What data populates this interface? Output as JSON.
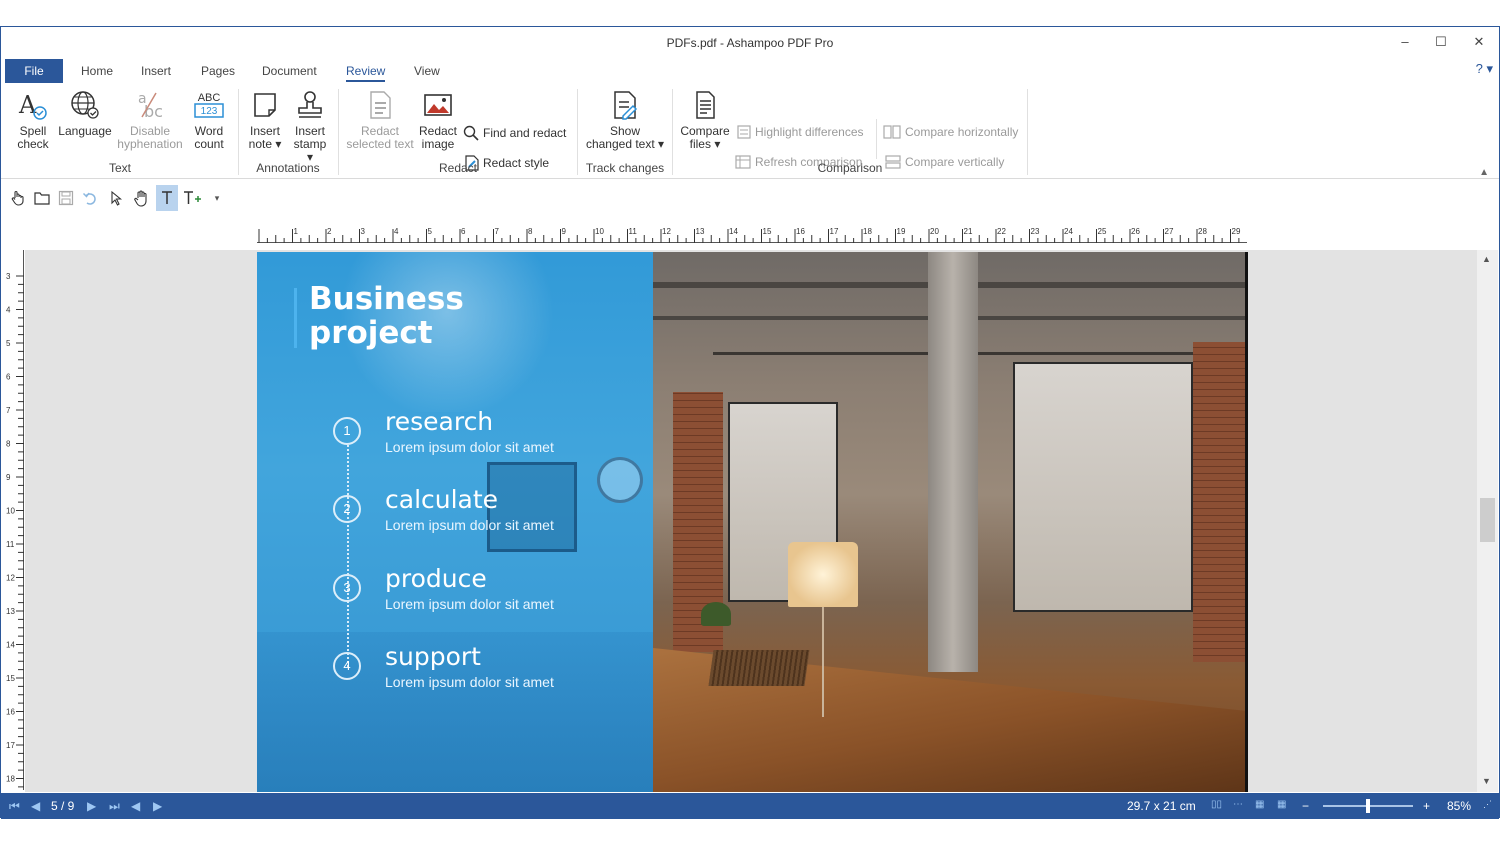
{
  "window": {
    "title": "PDFs.pdf - Ashampoo PDF Pro",
    "minimize": "–",
    "maximize": "☐",
    "close": "✕"
  },
  "tabs": [
    "File",
    "Home",
    "Insert",
    "Pages",
    "Document",
    "Review",
    "View"
  ],
  "active_tab": "Review",
  "help": "? ▾",
  "ribbon": {
    "spell_check": [
      "Spell",
      "check"
    ],
    "language": "Language",
    "disable_hyphenation": [
      "Disable",
      "hyphenation"
    ],
    "word_count": [
      "Word",
      "count"
    ],
    "group_text": "Text",
    "insert_note": [
      "Insert",
      "note ▾"
    ],
    "insert_stamp": [
      "Insert",
      "stamp ▾"
    ],
    "group_annotations": "Annotations",
    "redact_selected": [
      "Redact",
      "selected text"
    ],
    "redact_image": [
      "Redact",
      "image"
    ],
    "find_and_redact": "Find and redact",
    "redact_style": "Redact style",
    "group_redact": "Redact",
    "show_changed": [
      "Show",
      "changed text ▾"
    ],
    "group_track": "Track changes",
    "compare_files": [
      "Compare",
      "files ▾"
    ],
    "highlight_differences": "Highlight differences",
    "refresh_comparison": "Refresh comparison",
    "compare_horizontally": "Compare horizontally",
    "compare_vertically": "Compare vertically",
    "group_comparison": "Comparison",
    "abc_label": "ABC",
    "num_label": "123"
  },
  "ruler": {
    "h_labels": [
      "1",
      "2",
      "3",
      "4",
      "5",
      "6",
      "7",
      "8",
      "9",
      "10",
      "11",
      "12",
      "13",
      "14",
      "15",
      "16",
      "17",
      "18",
      "19",
      "20",
      "21",
      "22",
      "23",
      "24",
      "25",
      "26",
      "27",
      "28",
      "29"
    ],
    "v_labels": [
      "3",
      "4",
      "5",
      "6",
      "7",
      "8",
      "9",
      "10",
      "11",
      "12",
      "13",
      "14",
      "15",
      "16",
      "17",
      "18"
    ]
  },
  "document": {
    "title_line1": "Business",
    "title_line2": "project",
    "steps": [
      {
        "num": "1",
        "heading": "research",
        "sub": "Lorem ipsum dolor sit amet"
      },
      {
        "num": "2",
        "heading": "calculate",
        "sub": "Lorem ipsum dolor sit amet"
      },
      {
        "num": "3",
        "heading": "produce",
        "sub": "Lorem ipsum dolor sit amet"
      },
      {
        "num": "4",
        "heading": "support",
        "sub": "Lorem ipsum dolor sit amet"
      }
    ]
  },
  "status": {
    "page": "5 / 9",
    "size": "29.7 x 21 cm",
    "zoom": "85%",
    "zoom_level": 0.5
  },
  "colors": {
    "accent": "#2b579a",
    "panel_blue": "#2896d7"
  }
}
